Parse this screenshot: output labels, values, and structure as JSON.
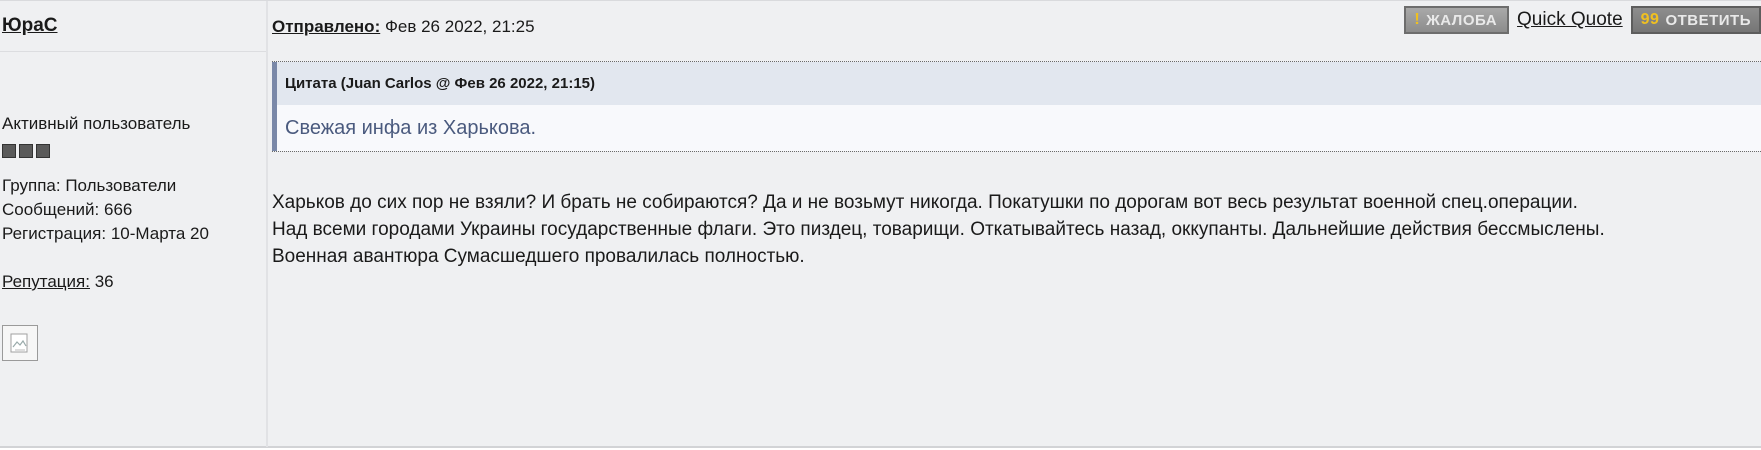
{
  "author": {
    "name": "ЮраС",
    "title": "Активный пользователь",
    "group": "Группа: Пользователи",
    "posts": "Сообщений: 666",
    "registered": "Регистрация: 10-Марта 20",
    "reputation_label": "Репутация:",
    "reputation_value": "36",
    "rank_pips": 3
  },
  "post_header": {
    "sent_label": "Отправлено:",
    "sent_value": "Фев 26 2022, 21:25"
  },
  "buttons": {
    "report_label": "ЖАЛОБА",
    "quick_quote_label": "Quick Quote",
    "reply_label": "ОТВЕТИТЬ"
  },
  "quote": {
    "title_bold": "Цитата",
    "title_rest": "(Juan Carlos @ Фев 26 2022, 21:15)",
    "text": "Свежая инфа из Харькова."
  },
  "message": {
    "lines": [
      "Харьков до сих пор не взяли? И брать не собираются? Да и не возьмут никогда. Покатушки по дорогам вот весь результат военной спец.операции.",
      "Над всеми городами Украины государственные флаги. Это пиздец, товарищи. Откатывайтесь назад, оккупанты. Дальнейшие действия бессмыслены.",
      "Военная авантюра Сумасшедшего провалилась полностью."
    ]
  },
  "colors": {
    "post_bg": "#eff0f2",
    "quote_header_bg": "#e2e7ef",
    "quote_text": "#4a5a7e",
    "quote_bar": "#7a88a8",
    "button_accent": "#f0c020"
  }
}
